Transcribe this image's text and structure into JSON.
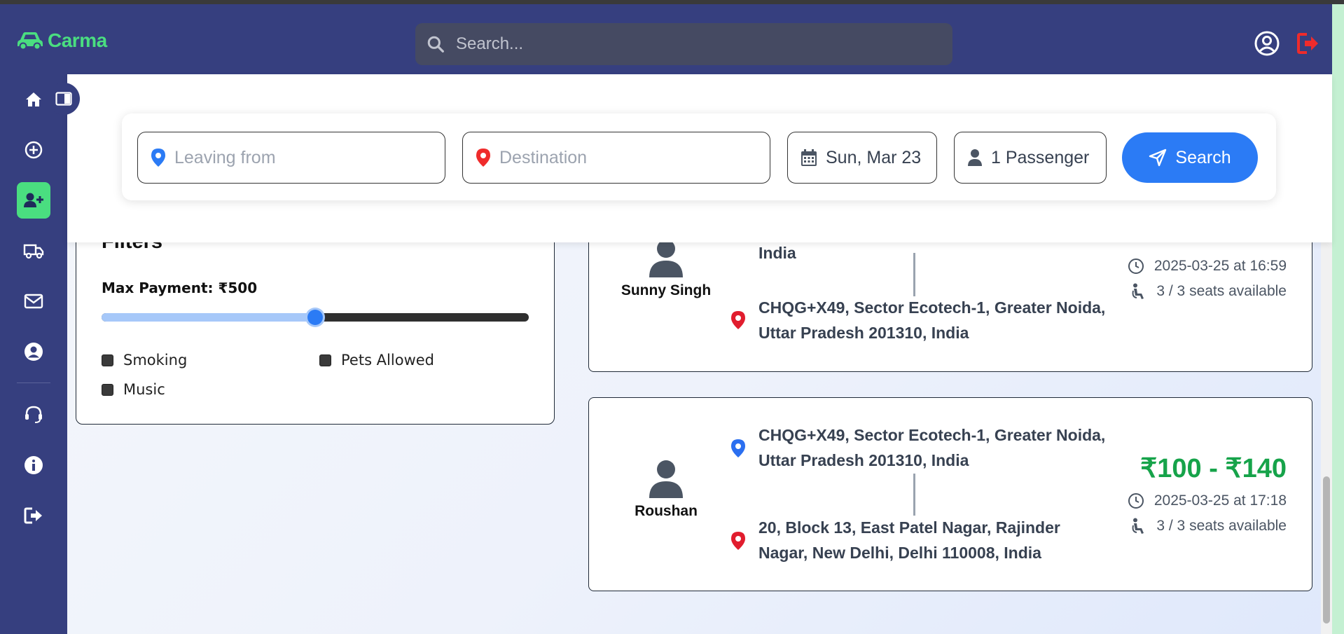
{
  "app": {
    "name": "Carma"
  },
  "header": {
    "search_placeholder": "Search..."
  },
  "colors": {
    "nav": "#363f7f",
    "accent_green": "#4ade80",
    "primary_blue": "#2b7bf5",
    "logout_red": "#ef2b2b",
    "price_green": "#16a34a"
  },
  "sidebar": {
    "items": [
      {
        "icon": "home-icon"
      },
      {
        "icon": "plus-circle-icon"
      },
      {
        "icon": "user-plus-icon",
        "active": true
      },
      {
        "icon": "truck-icon"
      },
      {
        "icon": "envelope-icon"
      },
      {
        "icon": "user-circle-icon"
      },
      {
        "icon": "headset-icon"
      },
      {
        "icon": "info-icon"
      },
      {
        "icon": "sign-out-icon"
      }
    ]
  },
  "search_form": {
    "leaving_placeholder": "Leaving from",
    "destination_placeholder": "Destination",
    "date": "Sun, Mar 23",
    "passengers": "1 Passenger",
    "button_label": "Search"
  },
  "filters": {
    "title": "Filters",
    "max_payment_label": "Max Payment: ₹500",
    "slider_fraction": 0.5,
    "options": [
      {
        "label": "Smoking"
      },
      {
        "label": "Pets Allowed"
      },
      {
        "label": "Music"
      }
    ]
  },
  "rides": [
    {
      "driver": "Sunny Singh",
      "from_partial": "India",
      "to": "CHQG+X49, Sector Ecotech-1, Greater Noida, Uttar Pradesh 201310, India",
      "datetime": "2025-03-25 at 16:59",
      "seats": "3 / 3 seats available"
    },
    {
      "driver": "Roushan",
      "from": "CHQG+X49, Sector Ecotech-1, Greater Noida, Uttar Pradesh 201310, India",
      "to": "20, Block 13, East Patel Nagar, Rajinder Nagar, New Delhi, Delhi 110008, India",
      "price": "₹100 - ₹140",
      "datetime": "2025-03-25 at 17:18",
      "seats": "3 / 3 seats available"
    }
  ]
}
